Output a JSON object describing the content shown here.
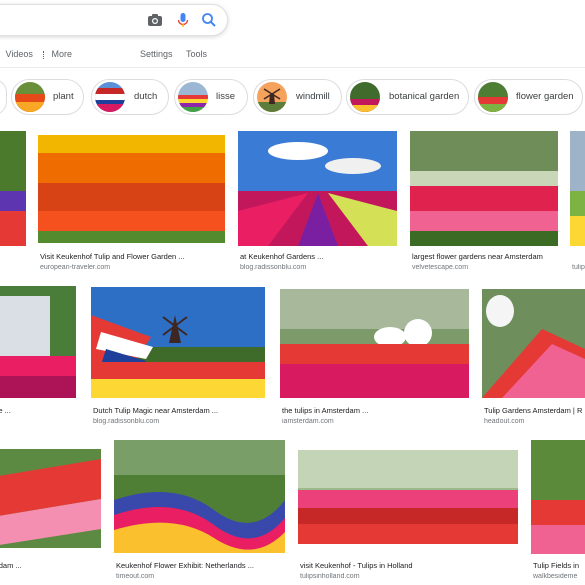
{
  "search": {
    "query": ""
  },
  "nav": {
    "videos": "Videos",
    "more": "More",
    "settings": "Settings",
    "tools": "Tools"
  },
  "chips": [
    {
      "label": "plant",
      "thumb": "tulip-field"
    },
    {
      "label": "dutch",
      "thumb": "flag"
    },
    {
      "label": "lisse",
      "thumb": "tulip-rows"
    },
    {
      "label": "windmill",
      "thumb": "windmill"
    },
    {
      "label": "botanical garden",
      "thumb": "garden"
    },
    {
      "label": "flower garden",
      "thumb": "garden"
    }
  ],
  "results": [
    {
      "caption": "Visit Keukenhof Tulip and Flower Garden ...",
      "source": "european-traveler.com"
    },
    {
      "caption": "at Keukenhof Gardens ...",
      "source": "blog.radissonblu.com"
    },
    {
      "caption": "largest flower gardens near Amsterdam",
      "source": "velvetescape.com"
    },
    {
      "caption": "",
      "source": "tulip"
    },
    {
      "caption": "ds: the ...",
      "source": ""
    },
    {
      "caption": "Dutch Tulip Magic near Amsterdam ...",
      "source": "blog.radissonblu.com"
    },
    {
      "caption": "the tulips in Amsterdam ...",
      "source": "iamsterdam.com"
    },
    {
      "caption": "Tulip Gardens Amsterdam | R",
      "source": "headout.com"
    },
    {
      "caption": "msterdam ...",
      "source": ""
    },
    {
      "caption": "Keukenhof Flower Exhibit: Netherlands ...",
      "source": "timeout.com"
    },
    {
      "caption": "visit Keukenhof - Tulips in Holland",
      "source": "tulipsinholland.com"
    },
    {
      "caption": "Tulip Fields in",
      "source": "walkbesideme"
    }
  ],
  "colors": {
    "google_blue": "#4285f4",
    "mic_red": "#ea4335",
    "camera_gray": "#5f6368"
  }
}
